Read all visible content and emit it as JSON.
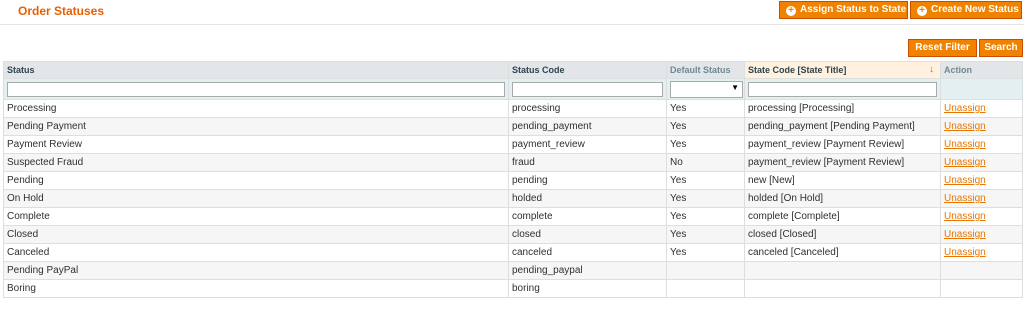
{
  "header": {
    "title": "Order Statuses",
    "assign_label": "Assign Status to State",
    "create_label": "Create New Status"
  },
  "toolbar": {
    "reset_label": "Reset Filter",
    "search_label": "Search"
  },
  "columns": {
    "status": "Status",
    "code": "Status Code",
    "default": "Default Status",
    "state": "State Code [State Title]",
    "action": "Action"
  },
  "colors": {
    "accent": "#eb5e00",
    "button": "#f18200",
    "link": "#ea7601"
  },
  "rows": [
    {
      "status": "Processing",
      "code": "processing",
      "default": "Yes",
      "state": "processing [Processing]",
      "action": "Unassign"
    },
    {
      "status": "Pending Payment",
      "code": "pending_payment",
      "default": "Yes",
      "state": "pending_payment [Pending Payment]",
      "action": "Unassign"
    },
    {
      "status": "Payment Review",
      "code": "payment_review",
      "default": "Yes",
      "state": "payment_review [Payment Review]",
      "action": "Unassign"
    },
    {
      "status": "Suspected Fraud",
      "code": "fraud",
      "default": "No",
      "state": "payment_review [Payment Review]",
      "action": "Unassign"
    },
    {
      "status": "Pending",
      "code": "pending",
      "default": "Yes",
      "state": "new [New]",
      "action": "Unassign"
    },
    {
      "status": "On Hold",
      "code": "holded",
      "default": "Yes",
      "state": "holded [On Hold]",
      "action": "Unassign"
    },
    {
      "status": "Complete",
      "code": "complete",
      "default": "Yes",
      "state": "complete [Complete]",
      "action": "Unassign"
    },
    {
      "status": "Closed",
      "code": "closed",
      "default": "Yes",
      "state": "closed [Closed]",
      "action": "Unassign"
    },
    {
      "status": "Canceled",
      "code": "canceled",
      "default": "Yes",
      "state": "canceled [Canceled]",
      "action": "Unassign"
    },
    {
      "status": "Pending PayPal",
      "code": "pending_paypal",
      "default": "",
      "state": "",
      "action": ""
    },
    {
      "status": "Boring",
      "code": "boring",
      "default": "",
      "state": "",
      "action": ""
    }
  ]
}
